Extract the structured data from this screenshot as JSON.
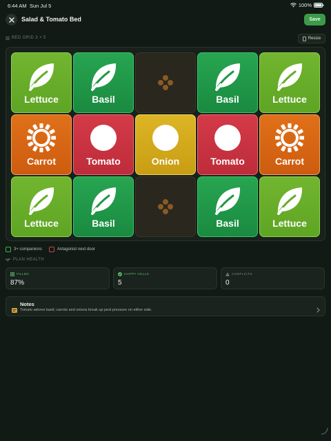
{
  "status_bar": {
    "time": "6:44 AM",
    "date": "Sun Jul 5",
    "battery": "100%"
  },
  "nav": {
    "title": "Salad & Tomato Bed",
    "save_label": "Save",
    "close_icon": "close-icon"
  },
  "grid_header": {
    "label": "BED GRID 3 × 5",
    "resize_label": "Resize"
  },
  "grid": {
    "rows": 3,
    "cols": 5,
    "cells": [
      {
        "plant": "Lettuce",
        "type": "lettuce",
        "icon": "leaf-icon"
      },
      {
        "plant": "Basil",
        "type": "basil",
        "icon": "leaf-icon"
      },
      {
        "plant": "",
        "type": "empty",
        "icon": "seed-icon"
      },
      {
        "plant": "Basil",
        "type": "basil",
        "icon": "leaf-icon"
      },
      {
        "plant": "Lettuce",
        "type": "lettuce",
        "icon": "leaf-icon"
      },
      {
        "plant": "Carrot",
        "type": "carrot",
        "icon": "sun-ring-icon"
      },
      {
        "plant": "Tomato",
        "type": "tomato",
        "icon": "circle-icon"
      },
      {
        "plant": "Onion",
        "type": "onion",
        "icon": "circle-icon"
      },
      {
        "plant": "Tomato",
        "type": "tomato",
        "icon": "circle-icon"
      },
      {
        "plant": "Carrot",
        "type": "carrot",
        "icon": "sun-ring-icon"
      },
      {
        "plant": "Lettuce",
        "type": "lettuce",
        "icon": "leaf-icon"
      },
      {
        "plant": "Basil",
        "type": "basil",
        "icon": "leaf-icon"
      },
      {
        "plant": "",
        "type": "empty",
        "icon": "seed-icon"
      },
      {
        "plant": "Basil",
        "type": "basil",
        "icon": "leaf-icon"
      },
      {
        "plant": "Lettuce",
        "type": "lettuce",
        "icon": "leaf-icon"
      }
    ]
  },
  "legend": {
    "companions": "3+ companions",
    "antagonist": "Antagonist next door"
  },
  "plan_health": {
    "title": "PLAN HEALTH",
    "stats": [
      {
        "label": "FILLED",
        "value": "87%",
        "icon": "grid-icon",
        "color": "#5fb86e"
      },
      {
        "label": "HAPPY CELLS",
        "value": "5",
        "icon": "check-circle-icon",
        "color": "#5fb86e"
      },
      {
        "label": "CONFLICTS",
        "value": "0",
        "icon": "warning-icon",
        "color": "#7c8a80"
      }
    ]
  },
  "notes": {
    "title": "Notes",
    "body": "Tomato adores basil; carrots and onions break up pest pressure on either side."
  },
  "colors": {
    "lettuce": "#68ad29",
    "basil": "#1f9848",
    "carrot": "#d8661a",
    "tomato": "#ca3441",
    "onion": "#d6ad1e",
    "empty": "#2a271f",
    "accent": "#3d9a4a"
  }
}
